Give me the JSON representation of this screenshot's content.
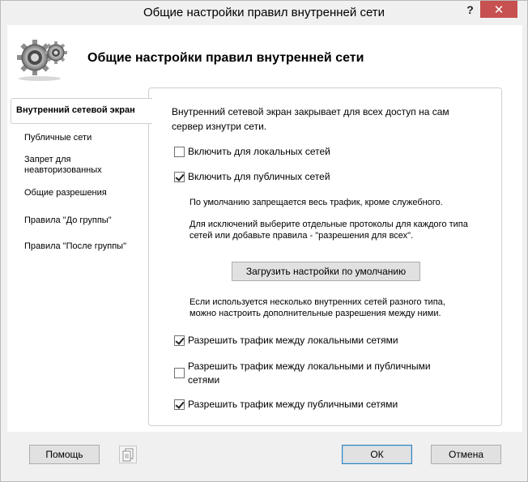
{
  "window": {
    "title": "Общие настройки правил внутренней сети",
    "help_glyph": "?",
    "close_glyph": "✕"
  },
  "header": {
    "title": "Общие настройки правил внутренней сети",
    "icon": "gears-icon"
  },
  "nav": {
    "items": [
      {
        "label": "Внутренний сетевой экран",
        "active": true
      },
      {
        "label": "Публичные сети"
      },
      {
        "label": "Запрет для\nнеавторизованных"
      },
      {
        "label": "Общие разрешения"
      },
      {
        "label": "Правила \"До группы\""
      },
      {
        "label": "Правила \"После группы\""
      }
    ]
  },
  "panel": {
    "intro": "Внутренний сетевой экран закрывает для всех доступ на сам\nсервер изнутри сети.",
    "enable_local": {
      "label": "Включить для локальных сетей",
      "checked": false
    },
    "enable_public": {
      "label": "Включить для публичных сетей",
      "checked": true
    },
    "note_default": "По умолчанию запрещается весь трафик, кроме служебного.",
    "note_exceptions": "Для исключений выберите отдельные протоколы для каждого типа\nсетей или добавьте правила - \"разрешения для всех\".",
    "load_defaults_button": "Загрузить настройки по умолчанию",
    "note_multi": "Если используется несколько внутренних сетей разного типа,\nможно настроить дополнительные разрешения между ними.",
    "allow_local_local": {
      "label": "Разрешить трафик между локальными сетями",
      "checked": true
    },
    "allow_local_public": {
      "label": "Разрешить трафик между локальными и публичными\nсетями",
      "checked": false
    },
    "allow_public_public": {
      "label": "Разрешить трафик между публичными сетями",
      "checked": true
    }
  },
  "footer": {
    "help_button": "Помощь",
    "ok_button": "ОК",
    "cancel_button": "Отмена"
  }
}
